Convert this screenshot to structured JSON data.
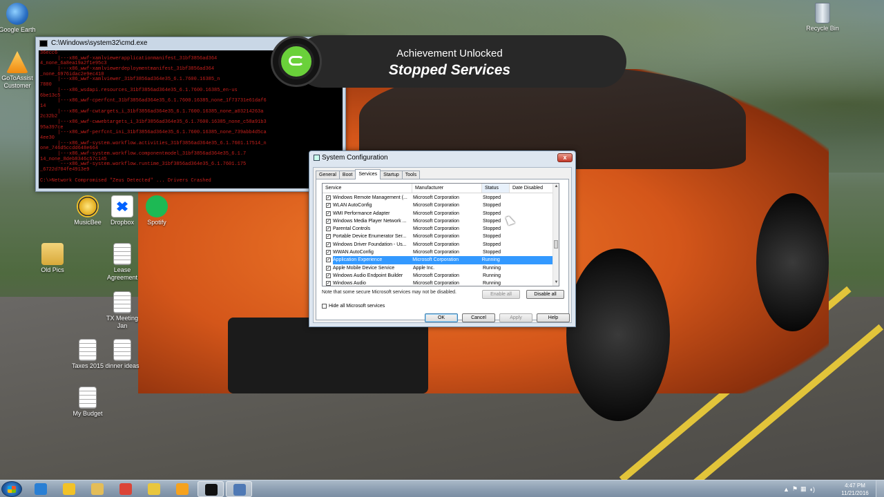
{
  "desktop": {
    "icons": [
      {
        "label": "Google Earth",
        "icon": "google-earth-icon",
        "color": "#3b7dd8"
      },
      {
        "label": "GoToAssist Customer",
        "icon": "gotoassist-icon",
        "color": "#f6a21e"
      },
      {
        "label": "MusicBee",
        "icon": "musicbee-icon",
        "color": "#f2c228"
      },
      {
        "label": "Dropbox",
        "icon": "dropbox-icon",
        "color": "#0061ff"
      },
      {
        "label": "Spotify",
        "icon": "spotify-icon",
        "color": "#1db954"
      },
      {
        "label": "Old Pics",
        "icon": "folder-icon",
        "color": "#e0b64a"
      },
      {
        "label": "Lease Agreement",
        "icon": "document-icon",
        "color": "#ffffff"
      },
      {
        "label": "TX Meeting Jan",
        "icon": "document-icon",
        "color": "#ffffff"
      },
      {
        "label": "Taxes 2015",
        "icon": "document-icon",
        "color": "#ffffff"
      },
      {
        "label": "dinner ideas",
        "icon": "document-icon",
        "color": "#ffffff"
      },
      {
        "label": "My Budget",
        "icon": "document-icon",
        "color": "#ffffff"
      },
      {
        "label": "Recycle Bin",
        "icon": "recycle-bin-icon",
        "color": "#cfd8e0"
      }
    ]
  },
  "cmd": {
    "title": "C:\\Windows\\system32\\cmd.exe",
    "lines": [
      "36ecc6",
      "      |---x86_wwf-xamlviewerapplicationmanifest_31bf3856ad364",
      "4_none_6a8ea19a2f1e95c3",
      "      |---x86_wwf-xamlviewerdeploymentmanifest_31bf3856ad364",
      "_none_6976idac2e9ec410",
      "      |---x86_wwf-xamlviewer_31bf3856ad364e35_6.1.7600.16385_n",
      "7880",
      "      |---x86_wsdapi.resources_31bf3856ad364e35_6.1.7600.16385_en-us",
      "6be13c5",
      "      |---x86_wwf-cperfcnt_31bf3856ad364e35_6.1.7600.16385_none_1f73731e61daf6",
      "14",
      "      |---x86_wwf-cwtargets_i_31bf3856ad364e35_6.1.7600.16385_none_a03214263a",
      "2c32b2",
      "      |---x86_wwf-cwwebtargets_i_31bf3856ad364e35_6.1.7600.16385_none_c58a91b3",
      "95a397ce",
      "      |---x86_wwf-perfcnt_ini_31bf3856ad364e35_6.1.7600.16385_none_739abb4d5ca",
      "4ee30",
      "      |---x86_wwf-system.workflow.activities_31bf3856ad364e35_6.1.7601.17514_n",
      "one_746d5ccdd648e664",
      "      |---x86_wwf-system.workflow.componentmodel_31bf3856ad364e35_6.1.7",
      "14_none_8deb8346c57c145",
      "      `---x86_wwf-system.workflow.runtime_31bf3856ad364e35_6.1.7601.175",
      "_6722d704fe4913e9",
      "",
      "C:\\>Network Compromised \"Zeus Detected\" ... Drivers Crashed"
    ]
  },
  "achievement": {
    "heading": "Achievement Unlocked",
    "title": "Stopped Services",
    "badge_color": "#6ad13a"
  },
  "syscfg": {
    "title": "System Configuration",
    "close_label": "x",
    "tabs": [
      {
        "label": "General",
        "active": false
      },
      {
        "label": "Boot",
        "active": false
      },
      {
        "label": "Services",
        "active": true
      },
      {
        "label": "Startup",
        "active": false
      },
      {
        "label": "Tools",
        "active": false
      }
    ],
    "columns": [
      "Service",
      "Manufacturer",
      "Status",
      "Date Disabled"
    ],
    "rows": [
      {
        "service": "Windows Remote Management (...",
        "manufacturer": "Microsoft Corporation",
        "status": "Stopped",
        "checked": true,
        "selected": false
      },
      {
        "service": "WLAN AutoConfig",
        "manufacturer": "Microsoft Corporation",
        "status": "Stopped",
        "checked": true,
        "selected": false
      },
      {
        "service": "WMI Performance Adapter",
        "manufacturer": "Microsoft Corporation",
        "status": "Stopped",
        "checked": true,
        "selected": false
      },
      {
        "service": "Windows Media Player Network ...",
        "manufacturer": "Microsoft Corporation",
        "status": "Stopped",
        "checked": true,
        "selected": false
      },
      {
        "service": "Parental Controls",
        "manufacturer": "Microsoft Corporation",
        "status": "Stopped",
        "checked": true,
        "selected": false
      },
      {
        "service": "Portable Device Enumerator Ser...",
        "manufacturer": "Microsoft Corporation",
        "status": "Stopped",
        "checked": true,
        "selected": false
      },
      {
        "service": "Windows Driver Foundation - Us...",
        "manufacturer": "Microsoft Corporation",
        "status": "Stopped",
        "checked": true,
        "selected": false
      },
      {
        "service": "WWAN AutoConfig",
        "manufacturer": "Microsoft Corporation",
        "status": "Stopped",
        "checked": true,
        "selected": false
      },
      {
        "service": "Application Experience",
        "manufacturer": "Microsoft Corporation",
        "status": "Running",
        "checked": true,
        "selected": true
      },
      {
        "service": "Apple Mobile Device Service",
        "manufacturer": "Apple Inc.",
        "status": "Running",
        "checked": true,
        "selected": false
      },
      {
        "service": "Windows Audio Endpoint Builder",
        "manufacturer": "Microsoft Corporation",
        "status": "Running",
        "checked": true,
        "selected": false
      },
      {
        "service": "Windows Audio",
        "manufacturer": "Microsoft Corporation",
        "status": "Running",
        "checked": true,
        "selected": false
      }
    ],
    "note": "Note that some secure Microsoft services may not be disabled.",
    "enable_all": "Enable all",
    "disable_all": "Disable all",
    "hide_ms_label": "Hide all Microsoft services",
    "ok": "OK",
    "cancel": "Cancel",
    "apply": "Apply",
    "help": "Help"
  },
  "taskbar": {
    "pinned": [
      {
        "icon": "internet-explorer-icon",
        "color": "#2a7fd4",
        "active": false
      },
      {
        "icon": "musicbee-icon",
        "color": "#f2c228",
        "active": false
      },
      {
        "icon": "file-explorer-icon",
        "color": "#e4bd58",
        "active": false
      },
      {
        "icon": "chrome-icon",
        "color": "#db4437",
        "active": false
      },
      {
        "icon": "help-icon",
        "color": "#e9c63d",
        "active": false
      },
      {
        "icon": "gotoassist-icon",
        "color": "#f6a21e",
        "active": false
      },
      {
        "icon": "cmd-icon",
        "color": "#111111",
        "active": true
      },
      {
        "icon": "system-configuration-icon",
        "color": "#4f79b5",
        "active": true
      }
    ],
    "time": "4:47 PM",
    "date": "11/21/2016"
  }
}
